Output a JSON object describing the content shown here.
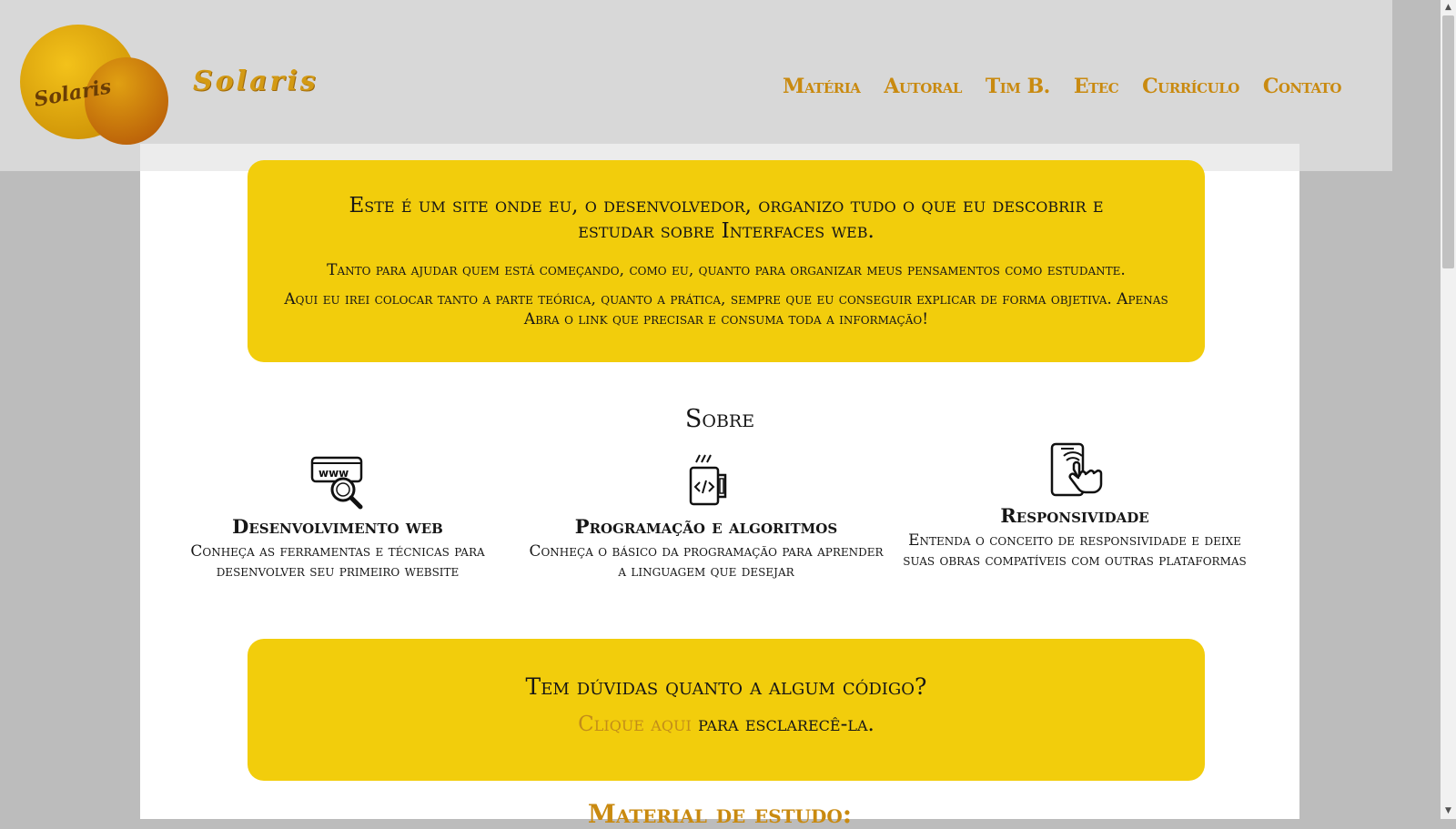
{
  "header": {
    "logo_text": "Solaris",
    "brand": "Solaris",
    "nav": [
      "Matéria",
      "Autoral",
      "Tim B.",
      "Etec",
      "Currículo",
      "Contato"
    ]
  },
  "intro": {
    "title": "Este é um site onde eu, o desenvolvedor, organizo tudo o que eu descobrir e estudar sobre Interfaces web.",
    "p1": "Tanto para ajudar quem está começando, como eu, quanto para organizar meus pensamentos como estudante.",
    "p2": "Aqui eu irei colocar tanto a parte teórica, quanto a prática, sempre que eu conseguir explicar de forma objetiva. Apenas Abra o link que precisar e consuma toda a informação!"
  },
  "sobre": {
    "heading": "Sobre",
    "features": [
      {
        "icon": "www-search-icon",
        "title": "Desenvolvimento web",
        "text": "Conheça as ferramentas e técnicas para desenvolver seu primeiro website"
      },
      {
        "icon": "code-mug-icon",
        "title": "Programação e algoritmos",
        "text": "Conheça o básico da programação para aprender a linguagem que desejar"
      },
      {
        "icon": "touch-phone-icon",
        "title": "Responsividade",
        "text": "Entenda o conceito de responsividade e deixe suas obras compatíveis com outras plataformas"
      }
    ]
  },
  "help": {
    "question": "Tem dúvidas quanto a algum código?",
    "link": "Clique aqui",
    "rest": " para esclarecê-la."
  },
  "material_heading": "Material de estudo:",
  "colors": {
    "accent": "#f2cd0c",
    "brand": "#c98a10",
    "header_bg": "#d8d8d8",
    "page_bg": "#bcbcbc"
  }
}
